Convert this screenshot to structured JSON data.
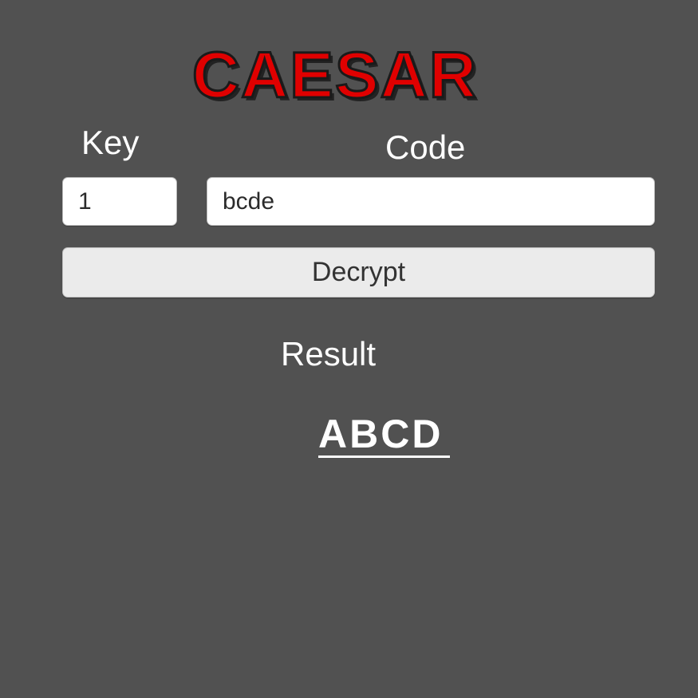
{
  "app": {
    "title": "CAESAR"
  },
  "form": {
    "key_label": "Key",
    "key_value": "1",
    "code_label": "Code",
    "code_value": "bcde",
    "decrypt_label": "Decrypt"
  },
  "result": {
    "label": "Result",
    "value": "ABCD"
  },
  "colors": {
    "background": "#515151",
    "title": "#e00000",
    "field_background": "#ffffff",
    "button_background": "#ebebeb",
    "text_light": "#ffffff"
  }
}
